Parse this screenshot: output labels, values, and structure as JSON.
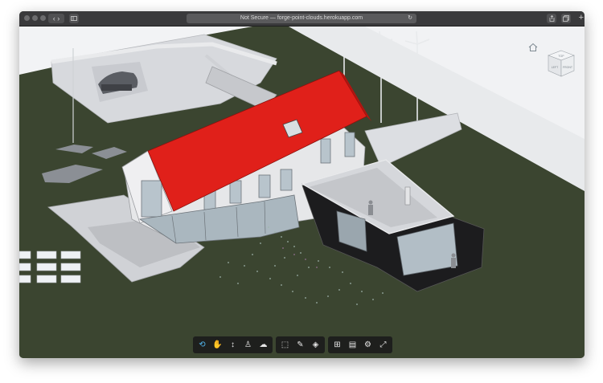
{
  "browser": {
    "address_text": "Not Secure — forge-point-clouds.herokuapp.com",
    "new_tab_label": "+"
  },
  "viewcube": {
    "top": "TOP",
    "left": "LEFT",
    "front": "FRONT"
  },
  "toolbar": {
    "groups": [
      {
        "tools": [
          {
            "name": "orbit-icon",
            "glyph": "⟲",
            "active": true
          },
          {
            "name": "pan-icon",
            "glyph": "✋",
            "active": false
          },
          {
            "name": "zoom-icon",
            "glyph": "↕",
            "active": false
          },
          {
            "name": "first-person-icon",
            "glyph": "♙",
            "active": false
          },
          {
            "name": "camera-icon",
            "glyph": "☁",
            "active": false
          }
        ]
      },
      {
        "tools": [
          {
            "name": "explode-icon",
            "glyph": "⬚",
            "active": false
          },
          {
            "name": "measure-icon",
            "glyph": "✎",
            "active": false
          },
          {
            "name": "section-icon",
            "glyph": "◈",
            "active": false
          }
        ]
      },
      {
        "tools": [
          {
            "name": "model-browser-icon",
            "glyph": "⊞",
            "active": false
          },
          {
            "name": "properties-icon",
            "glyph": "▤",
            "active": false
          },
          {
            "name": "settings-icon",
            "glyph": "⚙",
            "active": false
          },
          {
            "name": "fullscreen-icon",
            "glyph": "⤢",
            "active": false
          }
        ]
      }
    ]
  },
  "colors": {
    "ground": "#3b4530",
    "roof": "#e0201a",
    "toolbar_bg": "#1c1c1c",
    "active_tool": "#52b7f0"
  }
}
